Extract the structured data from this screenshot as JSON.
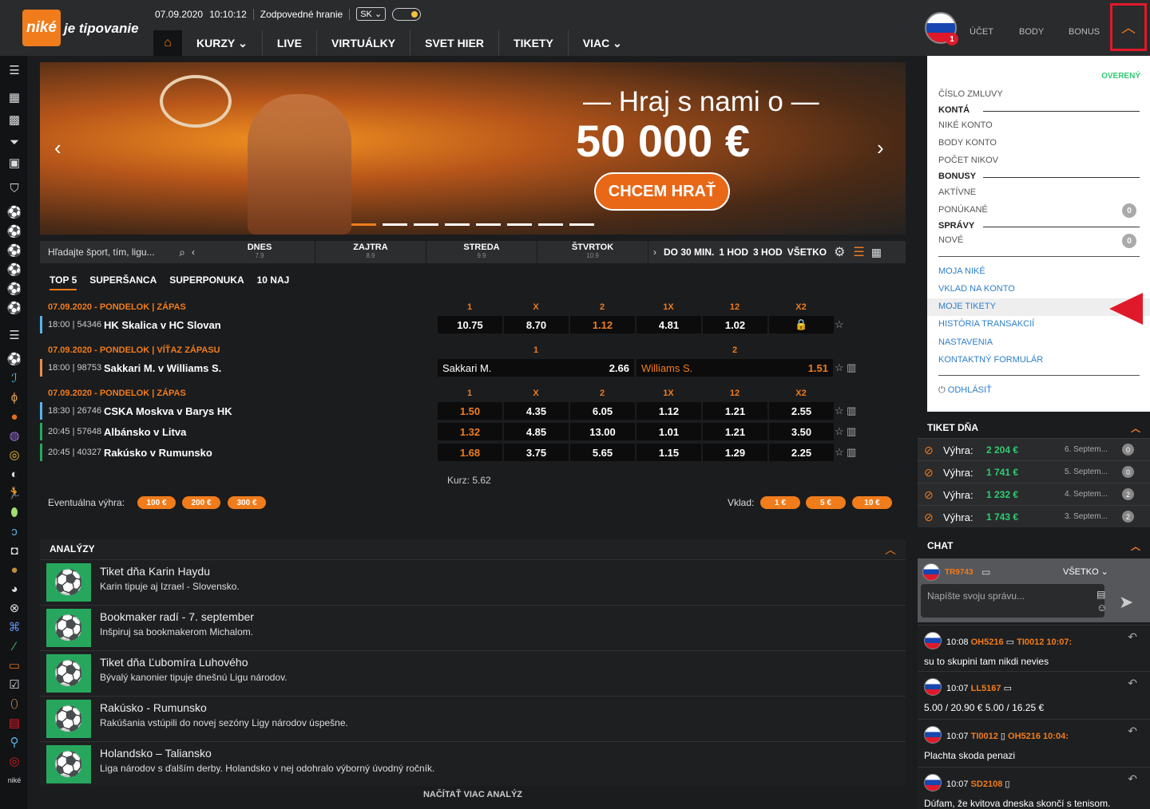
{
  "header": {
    "logo_text": "niké",
    "tagline": "je tipovanie",
    "date": "07.09.2020",
    "time": "10:10:12",
    "responsible": "Zodpovedné hranie",
    "lang": "SK",
    "nav": [
      "KURZY",
      "LIVE",
      "VIRTUÁLKY",
      "SVET HIER",
      "TIKETY",
      "VIAC"
    ],
    "account_badge": "1",
    "account_links": [
      "ÚČET",
      "BODY",
      "BONUS"
    ]
  },
  "banner": {
    "headline": "— Hraj s nami o —",
    "amount": "50 000 €",
    "cta": "CHCEM HRAŤ"
  },
  "filters": {
    "search_placeholder": "Hľadajte šport, tím, ligu...",
    "days": [
      {
        "label": "DNES",
        "date": "7.9"
      },
      {
        "label": "ZAJTRA",
        "date": "8.9"
      },
      {
        "label": "STREDA",
        "date": "9.9"
      },
      {
        "label": "ŠTVRTOK",
        "date": "10.9"
      }
    ],
    "timeframes": [
      "DO 30 MIN.",
      "1 HOD",
      "3 HOD",
      "VŠETKO"
    ]
  },
  "tabs": [
    "TOP 5",
    "SUPERŠANCA",
    "SUPERPONUKA",
    "10 NAJ"
  ],
  "sections": [
    {
      "title": "07.09.2020 - PONDELOK | ZÁPAS",
      "cols": [
        "1",
        "X",
        "2",
        "1X",
        "12",
        "X2"
      ]
    },
    {
      "title": "07.09.2020 - PONDELOK | VÍŤAZ ZÁPASU",
      "cols": [
        "1",
        "2"
      ]
    },
    {
      "title": "07.09.2020 - PONDELOK | ZÁPAS",
      "cols": [
        "1",
        "X",
        "2",
        "1X",
        "12",
        "X2"
      ]
    }
  ],
  "matches": [
    {
      "time": "18:00",
      "id": "54346",
      "teams": "HK Skalica v HC Slovan",
      "odds": [
        "10.75",
        "8.70",
        "1.12",
        "4.81",
        "1.02",
        ""
      ]
    },
    {
      "time": "18:00",
      "id": "98753",
      "teams": "Sakkari M. v Williams S.",
      "p1": "Sakkari M.",
      "o1": "2.66",
      "p2": "Williams S.",
      "o2": "1.51"
    },
    {
      "time": "18:30",
      "id": "26746",
      "teams": "CSKA Moskva v Barys HK",
      "odds": [
        "1.50",
        "4.35",
        "6.05",
        "1.12",
        "1.21",
        "2.55"
      ]
    },
    {
      "time": "20:45",
      "id": "57648",
      "teams": "Albánsko v Litva",
      "odds": [
        "1.32",
        "4.85",
        "13.00",
        "1.01",
        "1.21",
        "3.50"
      ]
    },
    {
      "time": "20:45",
      "id": "40327",
      "teams": "Rakúsko v Rumunsko",
      "odds": [
        "1.68",
        "3.75",
        "5.65",
        "1.15",
        "1.29",
        "2.25"
      ]
    }
  ],
  "ticket": {
    "kurz": "Kurz: 5.62",
    "win_label": "Eventuálna výhra:",
    "win_pills": [
      "100 €",
      "200 €",
      "300 €"
    ],
    "stake_label": "Vklad:",
    "stake_pills": [
      "1 €",
      "5 €",
      "10 €"
    ]
  },
  "analyses": {
    "title": "ANALÝZY",
    "items": [
      {
        "title": "Tiket dňa Karin Haydu",
        "desc": "Karin tipuje aj Izrael - Slovensko."
      },
      {
        "title": "Bookmaker radí - 7. september",
        "desc": "Inšpiruj sa bookmakerom Michalom."
      },
      {
        "title": "Tiket dňa Ľubomíra Luhového",
        "desc": "Bývalý kanonier tipuje dnešnú Ligu národov."
      },
      {
        "title": "Rakúsko - Rumunsko",
        "desc": "Rakúšania vstúpili do novej sezóny Ligy národov úspešne."
      },
      {
        "title": "Holandsko – Taliansko",
        "desc": "Liga národov s ďalším derby. Holandsko v nej odohralo výborný úvodný ročník."
      }
    ],
    "more": "NAČÍTAŤ VIAC ANALÝZ"
  },
  "dropdown": {
    "verified": "OVERENÝ",
    "contract": "ČÍSLO ZMLUVY",
    "konta": "KONTÁ",
    "konta_items": [
      "NIKÉ KONTO",
      "BODY KONTO",
      "POČET NIKOV"
    ],
    "bonusy": "BONUSY",
    "bonusy_items": [
      "AKTÍVNE",
      "PONÚKANÉ"
    ],
    "bonus_offered": "0",
    "spravy": "SPRÁVY",
    "spravy_items": [
      "NOVÉ"
    ],
    "new_count": "0",
    "links": [
      "MOJA NIKÉ",
      "VKLAD NA KONTO",
      "MOJE TIKETY",
      "HISTÓRIA TRANSAKCIÍ",
      "NASTAVENIA",
      "KONTAKTNÝ FORMULÁR"
    ],
    "logout": "ODHLÁSIŤ"
  },
  "tiket_dna": {
    "title": "TIKET DŇA",
    "rows": [
      {
        "label": "Výhra:",
        "amount": "2 204 €",
        "date": "6. Septem...",
        "n": "0"
      },
      {
        "label": "Výhra:",
        "amount": "1 741 €",
        "date": "5. Septem...",
        "n": "0"
      },
      {
        "label": "Výhra:",
        "amount": "1 232 €",
        "date": "4. Septem...",
        "n": "2"
      },
      {
        "label": "Výhra:",
        "amount": "1 743 €",
        "date": "3. Septem...",
        "n": "2"
      }
    ]
  },
  "chat": {
    "title": "CHAT",
    "user": "TR9743",
    "filter": "VŠETKO",
    "placeholder": "Napíšte svoju správu...",
    "messages": [
      {
        "time": "10:08",
        "user": "OH5216",
        "reply": "TI0012 10:07:",
        "text": "su to skupini tam nikdi nevies"
      },
      {
        "time": "10:07",
        "user": "LL5167",
        "reply": "",
        "text": "5.00 / 20.90 €   5.00 / 16.25 €"
      },
      {
        "time": "10:07",
        "user": "TI0012",
        "reply": "OH5216 10:04:",
        "text": "Plachta skoda penazi"
      },
      {
        "time": "10:07",
        "user": "SD2108",
        "reply": "",
        "text": "Dúfam, že kvitova dneska skončí s tenisom."
      }
    ]
  }
}
